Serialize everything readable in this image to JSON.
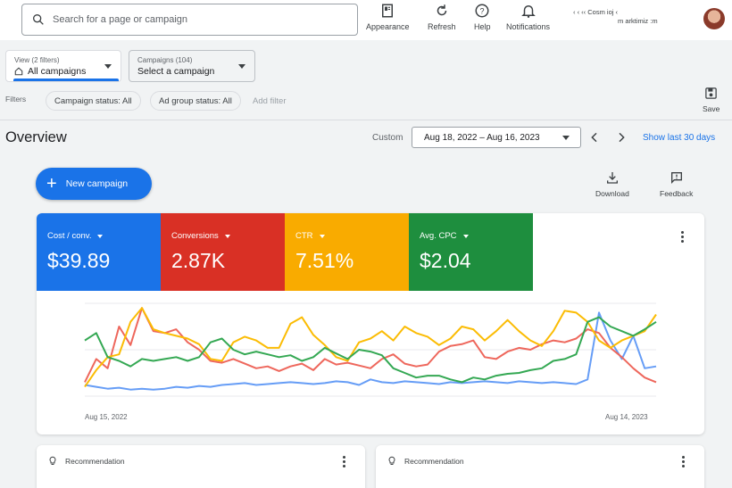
{
  "search": {
    "placeholder": "Search for a page or campaign"
  },
  "toolbar": {
    "appearance": "Appearance",
    "refresh": "Refresh",
    "help": "Help",
    "notifications": "Notifications"
  },
  "account": {
    "line1": "‹   ‹   ‹‹   Cosm   ioj   ‹",
    "line2": "m   arktimiz   :m"
  },
  "view": {
    "small": "View (2 filters)",
    "main": "All campaigns"
  },
  "campaigns": {
    "small": "Campaigns (104)",
    "main": "Select a campaign"
  },
  "filters": {
    "label": "Filters",
    "chips": [
      "Campaign status: All",
      "Ad group status: All"
    ],
    "add": "Add filter",
    "save": "Save"
  },
  "overview": {
    "title": "Overview",
    "custom": "Custom",
    "date_range": "Aug 18, 2022 – Aug 16, 2023",
    "show_last": "Show last 30 days"
  },
  "actions": {
    "new_campaign": "New campaign",
    "download": "Download",
    "feedback": "Feedback"
  },
  "colors": {
    "blue": "#1a73e8",
    "red": "#d93025",
    "yellow": "#f9ab00",
    "green": "#1e8e3e"
  },
  "metrics": [
    {
      "label": "Cost / conv.",
      "value": "$39.89",
      "color": "#1a73e8"
    },
    {
      "label": "Conversions",
      "value": "2.87K",
      "color": "#d93025"
    },
    {
      "label": "CTR",
      "value": "7.51%",
      "color": "#f9ab00"
    },
    {
      "label": "Avg. CPC",
      "value": "$2.04",
      "color": "#1e8e3e"
    }
  ],
  "chart_data": {
    "type": "line",
    "x_start": "Aug 15, 2022",
    "x_end": "Aug 14, 2023",
    "grid": true,
    "series": [
      {
        "name": "Cost / conv.",
        "color": "#669df6",
        "values": [
          12,
          10,
          8,
          9,
          7,
          8,
          7,
          8,
          10,
          9,
          11,
          10,
          12,
          13,
          14,
          12,
          13,
          14,
          15,
          14,
          13,
          14,
          16,
          15,
          12,
          18,
          15,
          14,
          16,
          15,
          14,
          13,
          15,
          14,
          15,
          16,
          15,
          14,
          16,
          15,
          14,
          15,
          14,
          13,
          18,
          90,
          60,
          40,
          65,
          30,
          32
        ]
      },
      {
        "name": "Conversions",
        "color": "#ee675c",
        "values": [
          15,
          40,
          30,
          75,
          55,
          95,
          70,
          68,
          72,
          58,
          50,
          38,
          36,
          40,
          35,
          30,
          32,
          27,
          32,
          35,
          28,
          40,
          34,
          36,
          33,
          30,
          40,
          45,
          35,
          32,
          34,
          48,
          54,
          56,
          60,
          42,
          40,
          48,
          52,
          50,
          56,
          60,
          58,
          62,
          72,
          68,
          52,
          42,
          30,
          20,
          15
        ]
      },
      {
        "name": "CTR",
        "color": "#fbbc04",
        "values": [
          10,
          28,
          42,
          45,
          80,
          95,
          72,
          68,
          65,
          62,
          56,
          40,
          38,
          58,
          64,
          60,
          52,
          52,
          78,
          85,
          66,
          55,
          42,
          38,
          58,
          62,
          70,
          60,
          75,
          68,
          64,
          55,
          62,
          75,
          72,
          60,
          70,
          82,
          70,
          60,
          54,
          70,
          92,
          90,
          80,
          60,
          52,
          60,
          65,
          70,
          88
        ]
      },
      {
        "name": "Avg. CPC",
        "color": "#34a853",
        "values": [
          60,
          68,
          42,
          38,
          32,
          40,
          38,
          40,
          42,
          38,
          42,
          58,
          62,
          50,
          45,
          48,
          45,
          42,
          44,
          38,
          42,
          52,
          46,
          40,
          50,
          48,
          44,
          30,
          25,
          20,
          22,
          22,
          18,
          15,
          20,
          18,
          22,
          24,
          25,
          28,
          30,
          38,
          40,
          45,
          80,
          85,
          75,
          70,
          65,
          72,
          80
        ]
      }
    ]
  },
  "recommendations": [
    {
      "title": "Recommendation"
    },
    {
      "title": "Recommendation"
    }
  ]
}
